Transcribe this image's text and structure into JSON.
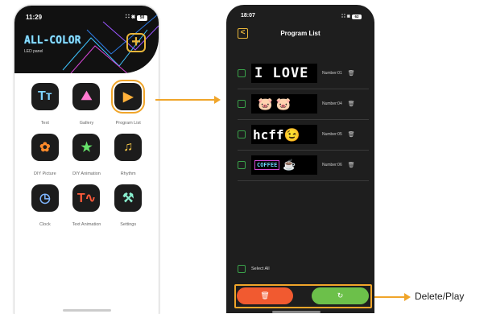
{
  "phone1": {
    "status_time": "11:29",
    "status_icons": "∷ ⨳",
    "battery": "50",
    "logo_main": "ALL-COLOR",
    "logo_sub": "LED panel",
    "add_glyph": "+",
    "items": [
      {
        "label": "Text",
        "glyph": "Tᴛ",
        "color": "#7fd3ff"
      },
      {
        "label": "Gallery",
        "glyph": "⛰",
        "color": "#ff7ad0"
      },
      {
        "label": "Program List",
        "glyph": "▶",
        "color": "#ffb13b"
      },
      {
        "label": "DIY Picture",
        "glyph": "✿",
        "color": "#ff8a2a"
      },
      {
        "label": "DIY Animation",
        "glyph": "★",
        "color": "#66e36b"
      },
      {
        "label": "Rhythm",
        "glyph": "♫",
        "color": "#ffcf4a"
      },
      {
        "label": "Clock",
        "glyph": "◷",
        "color": "#7fb6ff"
      },
      {
        "label": "Text Animation",
        "glyph": "T∿",
        "color": "#ff5a3a"
      },
      {
        "label": "Settings",
        "glyph": "⚒",
        "color": "#8af0d0"
      }
    ]
  },
  "phone2": {
    "status_time": "18:07",
    "status_icons": "∷ ⨳",
    "battery": "62",
    "back_glyph": "<",
    "title": "Program List",
    "programs": [
      {
        "preview": "I LOVE Y",
        "number": "Number:01"
      },
      {
        "preview": "🐷 🐷",
        "number": "Number:04"
      },
      {
        "preview": "hcff😉",
        "number": "Number:05"
      },
      {
        "preview": "COFFEE",
        "extra": "☕",
        "number": "Number:06"
      }
    ],
    "trash_glyph": "🗑",
    "select_all": "Select All",
    "delete_glyph": "🗑",
    "play_glyph": "↻"
  },
  "annotation": {
    "label": "Delete/Play",
    "color": "#f0a52a"
  }
}
